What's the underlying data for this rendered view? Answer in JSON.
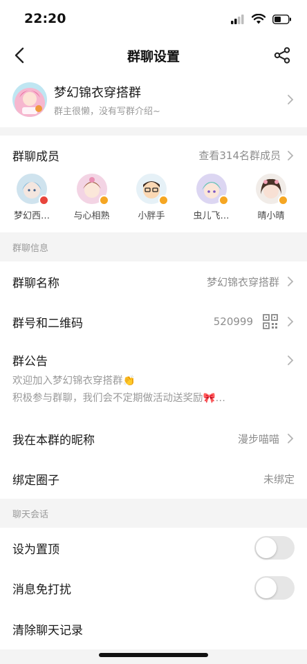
{
  "status": {
    "time": "22:20"
  },
  "nav": {
    "title": "群聊设置"
  },
  "group": {
    "name": "梦幻锦衣穿搭群",
    "desc": "群主很懒，没有写群介绍~"
  },
  "members": {
    "title": "群聊成员",
    "link": "查看314名群成员",
    "items": [
      {
        "name": "梦幻西…"
      },
      {
        "name": "与心相熟"
      },
      {
        "name": "小胖手"
      },
      {
        "name": "虫儿飞…"
      },
      {
        "name": "晴小晴"
      }
    ]
  },
  "section_info": {
    "label": "群聊信息"
  },
  "info": {
    "name_label": "群聊名称",
    "name_value": "梦幻锦衣穿搭群",
    "id_label": "群号和二维码",
    "id_value": "520999",
    "notice_label": "群公告",
    "notice_line1": "欢迎加入梦幻锦衣穿搭群👏",
    "notice_line2": "积极参与群聊，我们会不定期做活动送奖励🎀…",
    "nickname_label": "我在本群的昵称",
    "nickname_value": "漫步喵喵",
    "circle_label": "绑定圈子",
    "circle_value": "未绑定"
  },
  "section_chat": {
    "label": "聊天会话"
  },
  "chat": {
    "pin_label": "设为置顶",
    "pin_on": false,
    "mute_label": "消息免打扰",
    "mute_on": false,
    "clear_label": "清除聊天记录"
  },
  "colors": {
    "badge_orange": "#f5a623",
    "badge_red": "#e8453c"
  }
}
